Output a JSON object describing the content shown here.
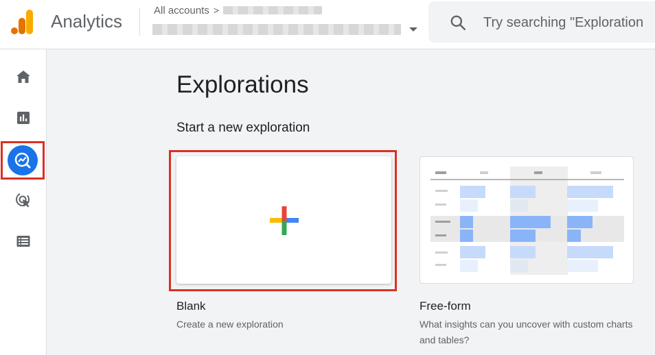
{
  "app": {
    "title": "Analytics"
  },
  "header": {
    "breadcrumb_all_accounts": "All accounts",
    "breadcrumb_separator": ">",
    "search_placeholder": "Try searching \"Exploration"
  },
  "sidebar": {
    "items": [
      {
        "name": "home",
        "icon": "home-icon",
        "active": false
      },
      {
        "name": "reports",
        "icon": "bar-chart-icon",
        "active": false
      },
      {
        "name": "explore",
        "icon": "explore-icon",
        "active": true
      },
      {
        "name": "advertising",
        "icon": "target-cursor-icon",
        "active": false
      },
      {
        "name": "configure",
        "icon": "list-icon",
        "active": false
      }
    ]
  },
  "main": {
    "page_title": "Explorations",
    "section_title": "Start a new exploration",
    "templates": [
      {
        "title": "Blank",
        "description": "Create a new exploration"
      },
      {
        "title": "Free-form",
        "description": "What insights can you uncover with custom charts and tables?"
      }
    ]
  },
  "colors": {
    "accent": "#1a73e8",
    "highlight_outline": "#d93025",
    "logo_orange": "#f9ab00",
    "logo_dark_orange": "#e37400"
  }
}
